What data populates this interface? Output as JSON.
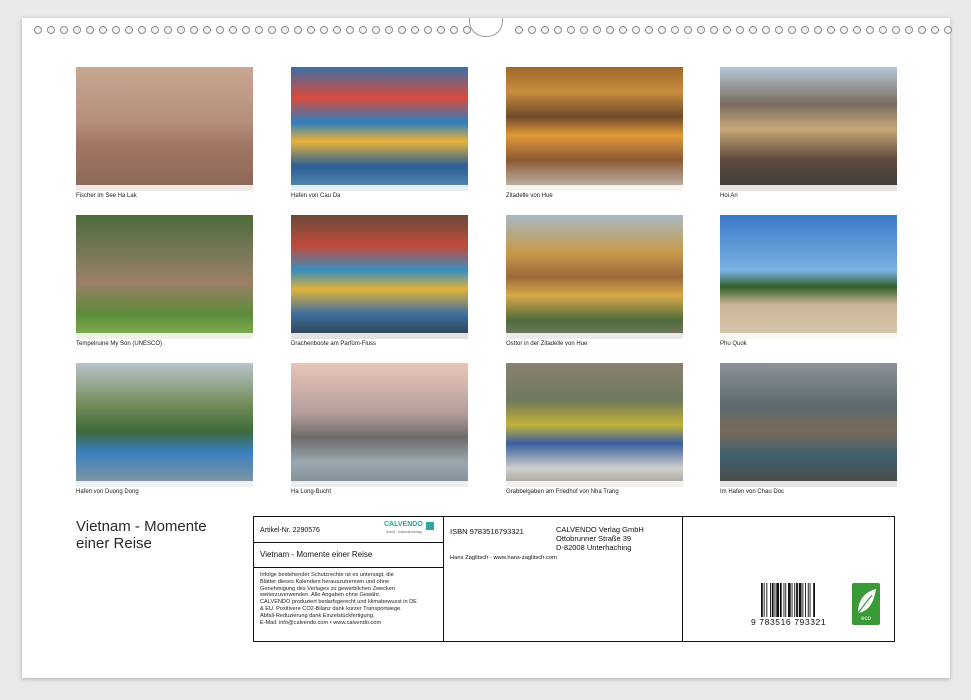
{
  "calendar": {
    "title_line1": "Vietnam - Momente",
    "title_line2": "einer Reise"
  },
  "photos": [
    {
      "caption": "Fischer im See Ha Lak",
      "icon": "fishing-net-image"
    },
    {
      "caption": "Hafen von Cau Da",
      "icon": "harbor-boats-image"
    },
    {
      "caption": "Zitadelle von Hue",
      "icon": "citadel-image"
    },
    {
      "caption": "Hoi An",
      "icon": "street-image"
    },
    {
      "caption": "Tempelruine My Son (UNESCO)",
      "icon": "temple-ruin-image"
    },
    {
      "caption": "Drachenboote am Parfüm-Fluss",
      "icon": "dragon-boats-image"
    },
    {
      "caption": "Osttor in der Zitadelle von Hue",
      "icon": "gate-image"
    },
    {
      "caption": "Phu Quok",
      "icon": "beach-image"
    },
    {
      "caption": "Hafen von Duong Dong",
      "icon": "harbor-image"
    },
    {
      "caption": "Ha Long-Bucht",
      "icon": "bay-image"
    },
    {
      "caption": "Grabbeigaben am Friedhof von Nha Trang",
      "icon": "grave-offerings-image"
    },
    {
      "caption": "Im Hafen von Chau Doc",
      "icon": "rowing-boats-image"
    }
  ],
  "info": {
    "article_no": "Artikel-Nr. 2290576",
    "logo_text": "CALVENDO",
    "logo_sub": "Kunst · Kalenderverlag",
    "title": "Vietnam - Momente einer Reise",
    "fine_print": [
      "Infolge bestehender Schutzrechte ist es untersagt, die",
      "Blätter dieses Kalenders herauszutrennen und ohne",
      "Genehmigung des Verlages zu gewerblichen Zwecken",
      "weiterzuverwenden. Alle Angaben ohne Gewähr.",
      "CALVENDO produziert bedarfsgerecht und klimabewusst in DE",
      "& EU. Positivere CO2-Bilanz dank kurzer Transportwege.",
      "Abfall-Reduzierung dank Einzelstückfertigung.",
      "E-Mail: info@calvendo.com • www.calvendo.com"
    ],
    "isbn": "ISBN 9783516793321",
    "publisher_line1": "CALVENDO Verlag GmbH",
    "publisher_line2": "Ottobrunner Straße 39",
    "publisher_line3": "D-82008 Unterhaching",
    "author": "Hans Zaglitsch - www.hans-zaglitsch.com",
    "barcode_digits": "9  783516  793321",
    "eco_label": "eco"
  },
  "colors": {
    "eco_green": "#3a9a36",
    "logo_teal": "#2aa7a0"
  }
}
